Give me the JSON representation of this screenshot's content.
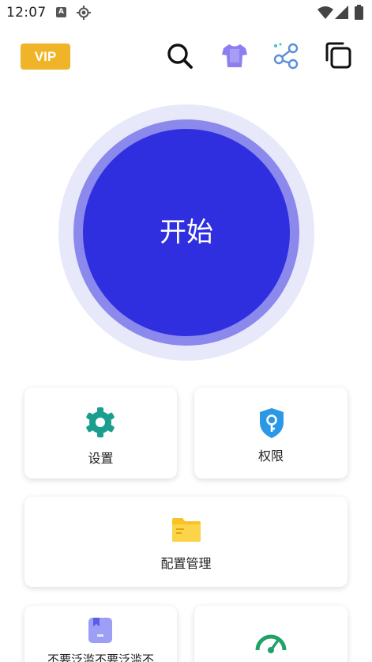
{
  "status_bar": {
    "time": "12:07",
    "keyboard_indicator": "A",
    "icons": [
      "location-target-icon",
      "wifi-icon",
      "signal-icon",
      "battery-icon"
    ]
  },
  "header": {
    "vip_label": "VIP",
    "icons": [
      "search-icon",
      "tshirt-icon",
      "share-icon",
      "copy-icon"
    ]
  },
  "start_button": {
    "label": "开始"
  },
  "cards": {
    "settings": {
      "label": "设置",
      "icon": "gear-icon"
    },
    "permission": {
      "label": "权限",
      "icon": "shield-key-icon"
    },
    "config": {
      "label": "配置管理",
      "icon": "folder-icon"
    },
    "app": {
      "label": "不要泛滥不要泛滥不",
      "icon": "bookmark-icon"
    },
    "speed": {
      "label": "",
      "icon": "speedometer-icon"
    }
  },
  "colors": {
    "vip": "#f0b429",
    "start_inner": "#2f2fe0",
    "start_ring": "#8b89ec",
    "start_halo": "#e8e8fb",
    "gear": "#1a9e8f",
    "shield": "#2b98e6",
    "folder": "#f7c325",
    "bookmark": "#9d9ef5",
    "speed": "#21a267"
  }
}
